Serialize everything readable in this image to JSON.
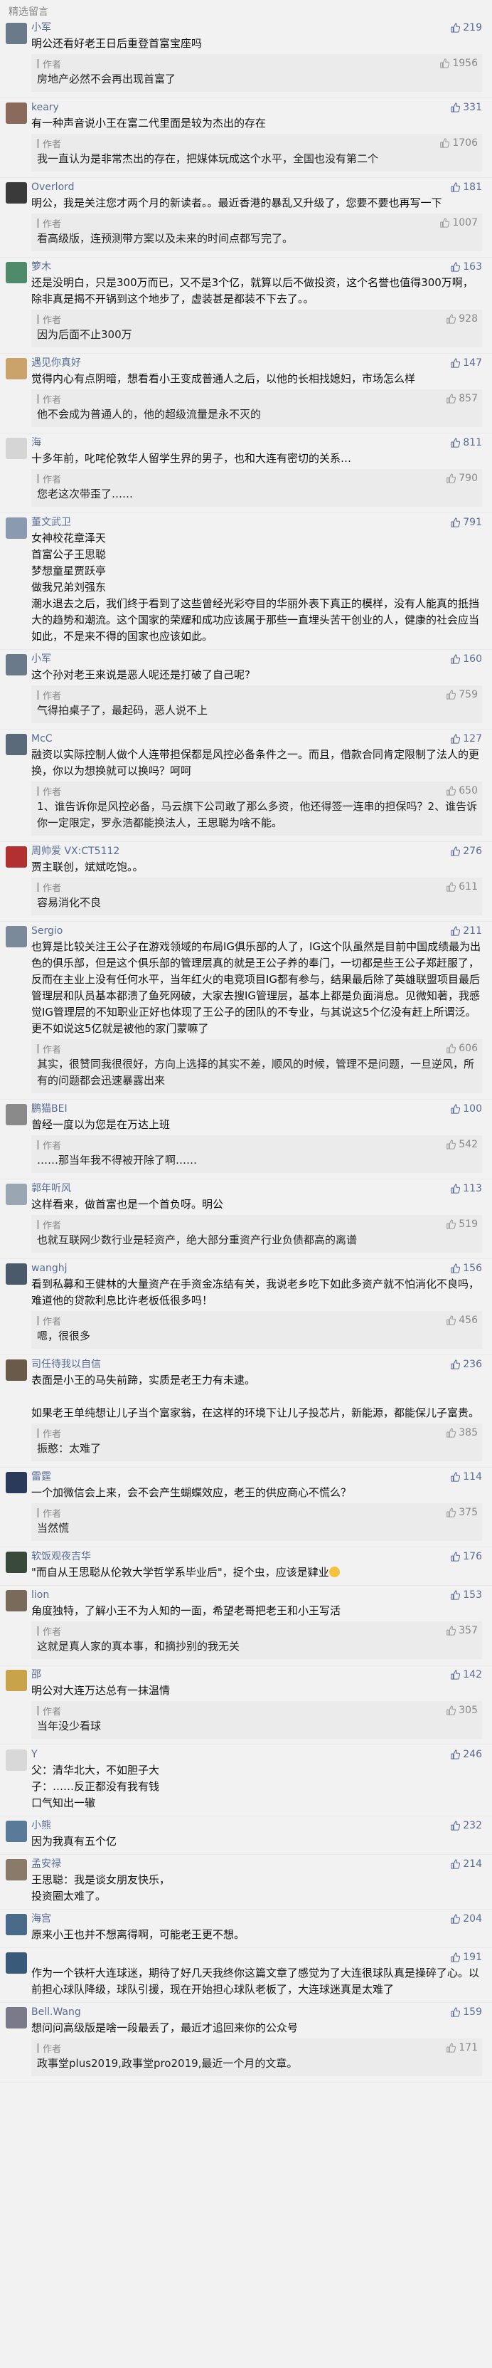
{
  "section_title": "精选留言",
  "author_label": "作者",
  "colors": {
    "link": "#576b95",
    "reply_bg": "#ebebeb",
    "page_bg": "#f2f2f2"
  },
  "comments": [
    {
      "name": "小军",
      "likes": "219",
      "avatar_color": "#6a7a8a",
      "text": "明公还看好老王日后重登首富宝座吗",
      "reply": "房地产必然不会再出现首富了",
      "reply_likes": "1956"
    },
    {
      "name": "keary",
      "likes": "331",
      "avatar_color": "#8a6a5a",
      "text": "有一种声音说小王在富二代里面是较为杰出的存在",
      "reply": "我一直认为是非常杰出的存在，把媒体玩成这个水平，全国也没有第二个",
      "reply_likes": "1706"
    },
    {
      "name": "Overlord",
      "likes": "181",
      "avatar_color": "#3a3a3a",
      "text": "明公，我是关注您才两个月的新读者。。最近香港的暴乱又升级了，您要不要也再写一下",
      "reply": "看高级版，连预测带方案以及未来的时间点都写完了。",
      "reply_likes": "1007"
    },
    {
      "name": "箩木",
      "likes": "163",
      "avatar_color": "#4f8a6a",
      "text": "还是没明白，只是300万而已，又不是3个亿，就算以后不做投资，这个名誉也值得300万啊，除非真是揭不开锅到这个地步了，虚装甚是都装不下去了。。",
      "reply": "因为后面不止300万",
      "reply_likes": "928"
    },
    {
      "name": "遇见你真好",
      "likes": "147",
      "avatar_color": "#c9a36a",
      "text": "觉得内心有点阴暗，想看看小王变成普通人之后，以他的长相找媳妇，市场怎么样",
      "reply": "他不会成为普通人的，他的超级流量是永不灭的",
      "reply_likes": "857"
    },
    {
      "name": "海",
      "likes": "811",
      "avatar_color": "#d5d5d5",
      "text": "十多年前，叱咤伦敦华人留学生界的男子，也和大连有密切的关系…",
      "reply": "您老这次带歪了……",
      "reply_likes": "790"
    },
    {
      "name": "董文武卫",
      "likes": "791",
      "avatar_color": "#8a9ab0",
      "text": "女神校花章泽天\n首富公子王思聪\n梦想童星贾跃亭\n做我兄弟刘强东\n潮水退去之后，我们终于看到了这些曾经光彩夺目的华丽外表下真正的模样，没有人能真的抵挡大的趋势和潮流。这个国家的荣耀和成功应该属于那些一直埋头苦干创业的人，健康的社会应当如此，不是来不得的国家也应该如此。",
      "reply": "",
      "reply_likes": ""
    },
    {
      "name": "小军",
      "likes": "160",
      "avatar_color": "#6a7a8a",
      "text": "这个孙对老王来说是恶人呢还是打破了自己呢?",
      "reply": "气得拍桌子了，最起码，恶人说不上",
      "reply_likes": "759"
    },
    {
      "name": "McC",
      "likes": "127",
      "avatar_color": "#5a6a7a",
      "text": "融资以实际控制人做个人连带担保都是风控必备条件之一。而且，借款合同肯定限制了法人的更换，你以为想换就可以换吗？呵呵",
      "reply": "1、谁告诉你是风控必备，马云旗下公司敢了那么多资，他还得签一连串的担保吗？2、谁告诉你一定限定，罗永浩都能换法人，王思聪为啥不能。",
      "reply_likes": "650"
    },
    {
      "name": "周帅爱 VX:CT5112",
      "likes": "276",
      "avatar_color": "#b23030",
      "text": "贾主联创，斌斌吃饱。。",
      "reply": "容易消化不良",
      "reply_likes": "611"
    },
    {
      "name": "Sergio",
      "likes": "211",
      "avatar_color": "#7a8a9a",
      "text": "也算是比较关注王公子在游戏领域的布局IG俱乐部的人了，IG这个队虽然是目前中国成绩最为出色的俱乐部，但是这个俱乐部的管理层真的就是王公子养的奉门，一切都是些王公子郑赶服了，反而在主业上没有任何水平，当年红火的电竞项目IG都有参与，结果最后除了英雄联盟项目最后管理层和队员基本都溃了鱼死网破，大家去搜IG管理层，基本上都是负面消息。见微知著，我感觉IG管理层的不知职业正好也体现了王公子的团队的不专业，与其说这5个亿没有赶上所谓泛。更不如说这5亿就是被他的家门蒙嘛了",
      "reply": "其实，很赞同我很很好，方向上选择的其实不差，顺风的时候，管理不是问题，一旦逆风，所有的问题都会迅速暴露出来",
      "reply_likes": "606"
    },
    {
      "name": "鹏猫BEI",
      "likes": "100",
      "avatar_color": "#8a8a8a",
      "text": "曾经一度以为您是在万达上班",
      "reply": "……那当年我不得被开除了啊……",
      "reply_likes": "542"
    },
    {
      "name": "郭年听风",
      "likes": "113",
      "avatar_color": "#9aa6b2",
      "text": "这样看来，做首富也是一个首负呀。明公",
      "reply": "也就互联网少数行业是轻资产，绝大部分重资产行业负债都高的离谱",
      "reply_likes": "519"
    },
    {
      "name": "wanghj",
      "likes": "156",
      "avatar_color": "#4a5a6a",
      "text": "看到私募和王健林的大量资产在手资金冻结有关，我说老乡吃下如此多资产就不怕消化不良吗，难道他的贷款利息比许老板低很多吗！",
      "reply": "嗯，很很多",
      "reply_likes": "456"
    },
    {
      "name": "司任待我以自信",
      "likes": "236",
      "avatar_color": "#6a5a4a",
      "text": "表面是小王的马失前蹄，实质是老王力有未逮。\n\n如果老王单纯想让儿子当个富家翁，在这样的环境下让儿子投芯片，新能源，都能保儿子富贵。",
      "reply": "振憨：太难了",
      "reply_likes": "385"
    },
    {
      "name": "雷霆",
      "likes": "114",
      "avatar_color": "#2a3a5a",
      "text": "一个加微信会上来，会不会产生蝴蝶效应，老王的供应商心不慌么？",
      "reply": "当然慌",
      "reply_likes": "375"
    },
    {
      "name": "软饭观夜吉华",
      "likes": "176",
      "avatar_color": "#3a4a3a",
      "text": "\"而自从王思聪从伦敦大学哲学系毕业后\"，捉个虫，应该是肄业",
      "emoji_after": true,
      "reply": "",
      "reply_likes": ""
    },
    {
      "name": "lion",
      "likes": "153",
      "avatar_color": "#7a6a5a",
      "text": "角度独特，了解小王不为人知的一面，希望老哥把老王和小王写活",
      "reply": "这就是真人家的真本事，和摘抄别的我无关",
      "reply_likes": "357"
    },
    {
      "name": "邵",
      "likes": "142",
      "avatar_color": "#c9a34a",
      "text": "明公对大连万达总有一抹温情",
      "reply": "当年没少看球",
      "reply_likes": "305"
    },
    {
      "name": "Y",
      "likes": "246",
      "avatar_color": "#d8d8d8",
      "text": "父：清华北大，不如胆子大\n子：……反正都没有我有钱\n口气知出一辙",
      "reply": "",
      "reply_likes": ""
    },
    {
      "name": "小熊",
      "likes": "232",
      "avatar_color": "#5a7a9a",
      "text": "因为我真有五个亿",
      "reply": "",
      "reply_likes": ""
    },
    {
      "name": "孟安禄",
      "likes": "214",
      "avatar_color": "#8a7a6a",
      "text": "王思聪：我是谈女朋友快乐，\n投资圈太难了。",
      "reply": "",
      "reply_likes": ""
    },
    {
      "name": "海宫",
      "likes": "204",
      "avatar_color": "#4a6a8a",
      "text": "原来小王也并不想离得啊，可能老王更不想。",
      "reply": "",
      "reply_likes": ""
    },
    {
      "name": "",
      "likes": "191",
      "avatar_color": "#3a5a7a",
      "text": "作为一个铁杆大连球迷，期待了好几天我终你这篇文章了感觉为了大连很球队真是操碎了心。以前担心球队降级，球队引援，现在开始担心球队老板了，大连球迷真是太难了",
      "reply": "",
      "reply_likes": ""
    },
    {
      "name": "Bell.Wang",
      "likes": "159",
      "avatar_color": "#7a7a8a",
      "text": "想问问高级版是啥一段最丢了，最近才追回来你的公众号",
      "reply": "政事堂plus2019,政事堂pro2019,最近一个月的文章。",
      "reply_likes": "171"
    }
  ]
}
